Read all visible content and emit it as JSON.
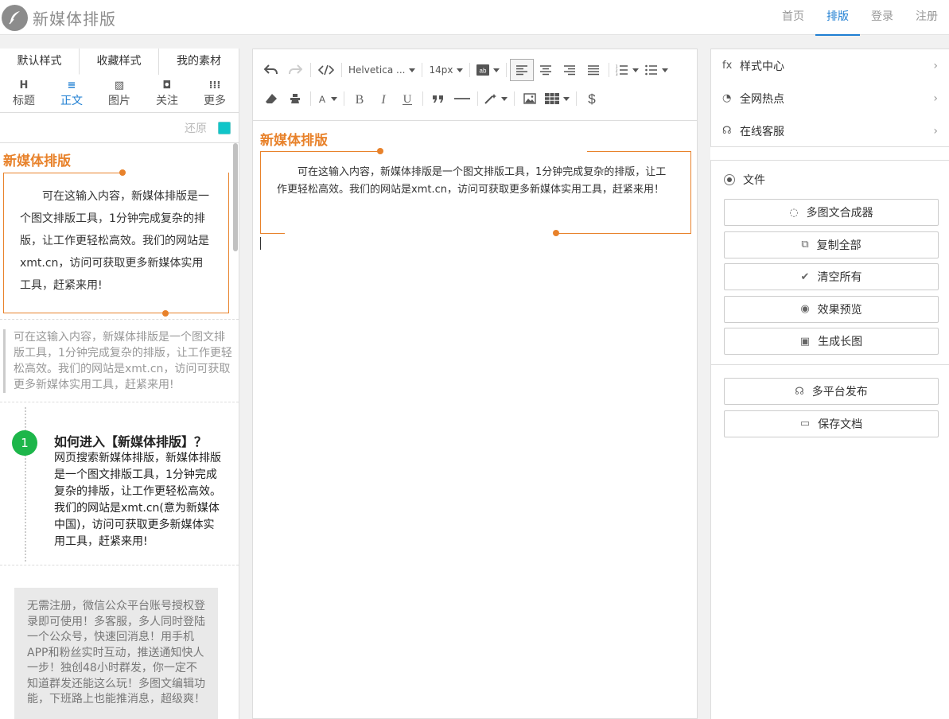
{
  "header": {
    "logo_text": "新媒体排版",
    "nav": [
      {
        "label": "首页",
        "active": false
      },
      {
        "label": "排版",
        "active": true
      },
      {
        "label": "登录",
        "active": false
      },
      {
        "label": "注册",
        "active": false
      }
    ]
  },
  "left": {
    "tabs": [
      "默认样式",
      "收藏样式",
      "我的素材"
    ],
    "categories": [
      {
        "icon": "H",
        "label": "标题"
      },
      {
        "icon": "≡",
        "label": "正文"
      },
      {
        "icon": "▨",
        "label": "图片"
      },
      {
        "icon": "◘",
        "label": "关注"
      },
      {
        "icon": "⁞⁞⁞",
        "label": "更多"
      }
    ],
    "restore_label": "还原",
    "swatch_color": "#10c5c9",
    "tpl1": {
      "title": "新媒体排版",
      "body": "可在这输入内容，新媒体排版是一个图文排版工具，1分钟完成复杂的排版，让工作更轻松高效。我们的网站是xmt.cn，访问可获取更多新媒体实用工具，赶紧来用!"
    },
    "tpl2": {
      "body": "可在这输入内容，新媒体排版是一个图文排版工具，1分钟完成复杂的排版，让工作更轻松高效。我们的网站是xmt.cn，访问可获取更多新媒体实用工具，赶紧来用!"
    },
    "tpl3": {
      "number": "1",
      "title": "如何进入【新媒体排版】？",
      "body": "网页搜索新媒体排版，新媒体排版是一个图文排版工具，1分钟完成复杂的排版，让工作更轻松高效。我们的网站是xmt.cn(意为新媒体中国)，访问可获取更多新媒体实用工具，赶紧来用!"
    },
    "tpl4": {
      "body": "无需注册，微信公众平台账号授权登录即可使用！多客服，多人同时登陆一个公众号，快速回消息！用手机APP和粉丝实时互动，推送通知快人一步！独创48小时群发，你一定不知道群发还能这么玩！多图文编辑功能，下班路上也能推消息，超级爽！"
    }
  },
  "editor": {
    "font_family": "Helvetica ...",
    "font_size": "14px",
    "doc_title": "新媒体排版",
    "doc_body": "可在这输入内容，新媒体排版是一个图文排版工具，1分钟完成复杂的排版，让工作更轻松高效。我们的网站是xmt.cn，访问可获取更多新媒体实用工具，赶紧来用！"
  },
  "right": {
    "menu": [
      {
        "icon": "fx",
        "label": "样式中心"
      },
      {
        "icon": "◔",
        "label": "全网热点"
      },
      {
        "icon": "☊",
        "label": "在线客服"
      }
    ],
    "file_label": "文件",
    "buttons_top": [
      {
        "icon": "◌",
        "label": "多图文合成器"
      },
      {
        "icon": "⧉",
        "label": "复制全部"
      },
      {
        "icon": "✔",
        "label": "清空所有"
      },
      {
        "icon": "◉",
        "label": "效果预览"
      },
      {
        "icon": "▣",
        "label": "生成长图"
      }
    ],
    "buttons_bottom": [
      {
        "icon": "☊",
        "label": "多平台发布"
      },
      {
        "icon": "▭",
        "label": "保存文档"
      }
    ]
  }
}
